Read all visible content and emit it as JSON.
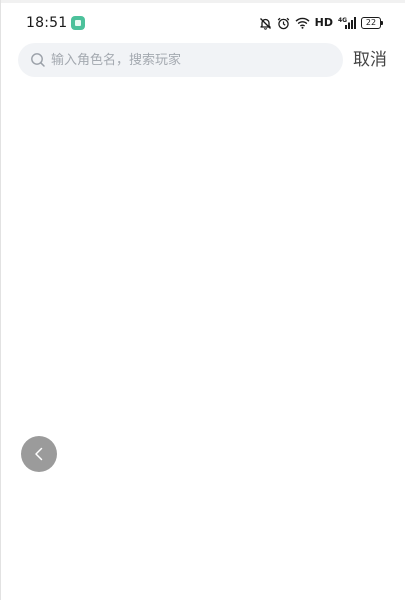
{
  "status_bar": {
    "time": "18:51",
    "network_label": "HD",
    "signal_label": "4G",
    "battery_level": "22",
    "icons": [
      "app-notification-icon",
      "mute-bell-icon",
      "alarm-icon",
      "wifi-icon",
      "signal-icon",
      "battery-icon"
    ]
  },
  "search": {
    "placeholder": "输入角色名，搜索玩家",
    "value": "",
    "cancel_label": "取消"
  },
  "back_button": {
    "icon": "chevron-left-icon"
  },
  "colors": {
    "search_bg": "#f1f3f6",
    "placeholder": "#a4a9b0",
    "back_button_bg": "#9b9b9b",
    "app_icon": "#4cc19b"
  }
}
